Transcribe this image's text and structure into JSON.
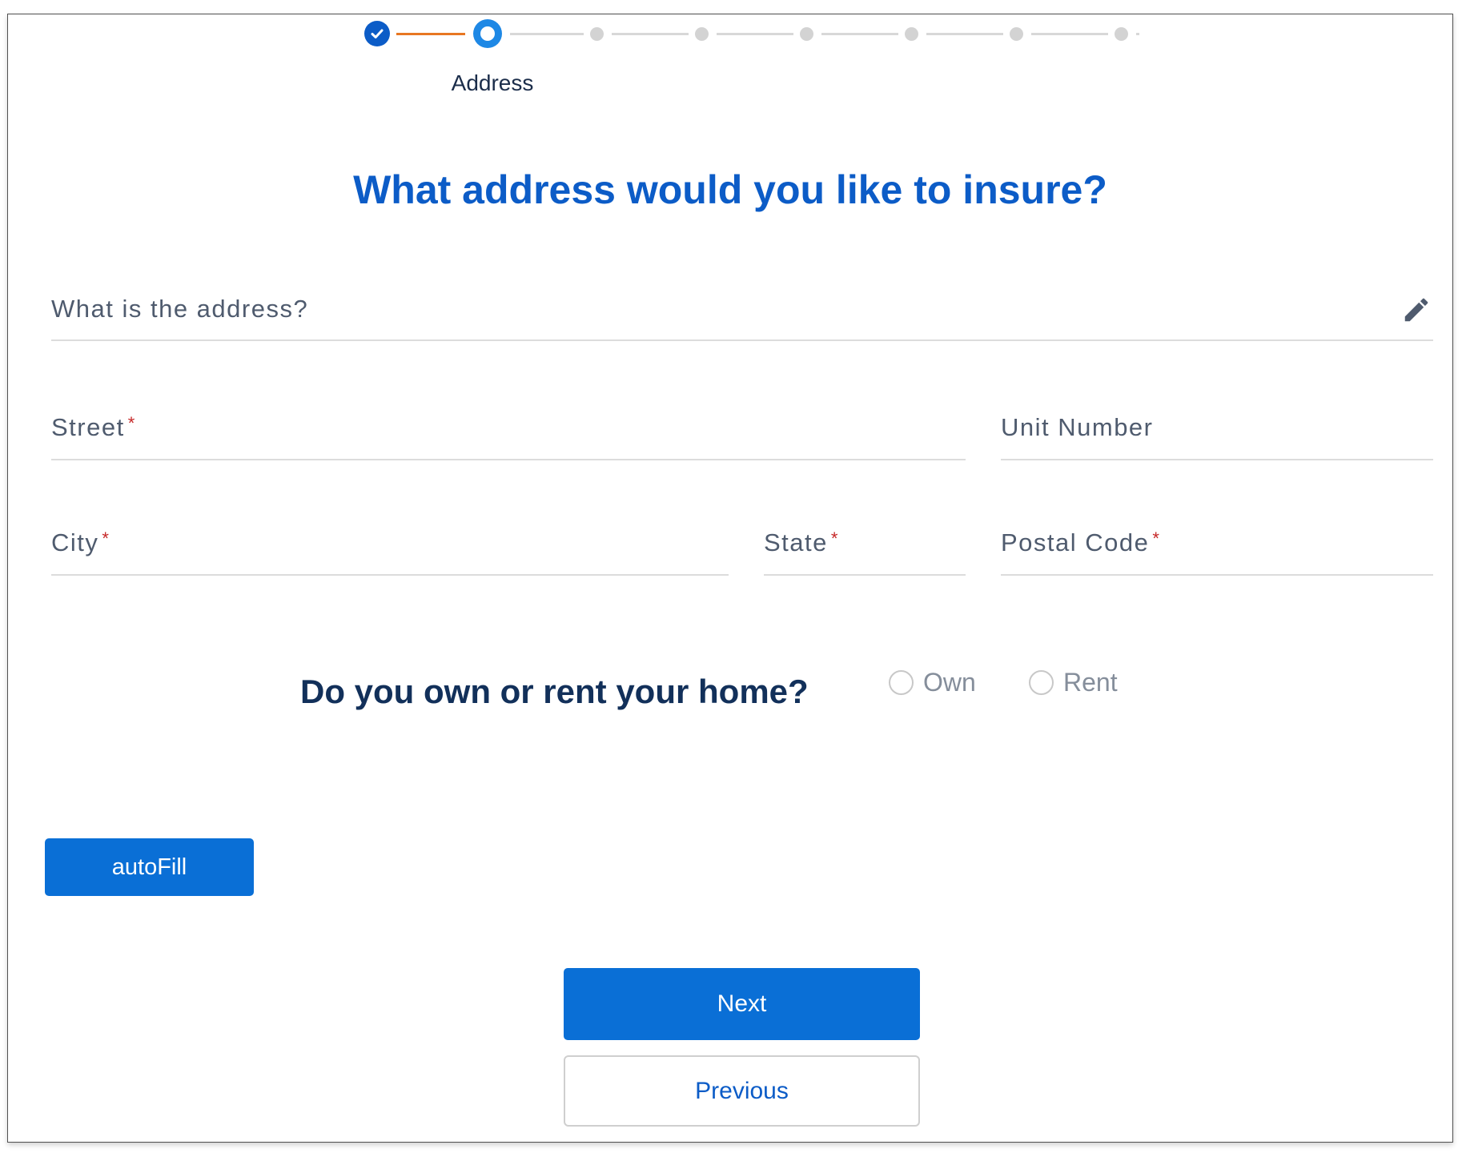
{
  "stepper": {
    "current_step_label": "Address"
  },
  "headline": "What address would you like to insure?",
  "fields": {
    "address_search": {
      "label": "What is the address?"
    },
    "street": {
      "label": "Street",
      "required_mark": "*"
    },
    "unit_number": {
      "label": "Unit Number"
    },
    "city": {
      "label": "City",
      "required_mark": "*"
    },
    "state": {
      "label": "State",
      "required_mark": "*"
    },
    "postal_code": {
      "label": "Postal Code",
      "required_mark": "*"
    }
  },
  "ownership": {
    "question": "Do you own or rent your home?",
    "options": [
      "Own",
      "Rent"
    ]
  },
  "buttons": {
    "autofill": "autoFill",
    "next": "Next",
    "previous": "Previous"
  },
  "colors": {
    "primary_blue": "#0a6fd6",
    "heading_blue": "#0c5cc7",
    "progress_orange": "#e87722",
    "required_red": "#c62828"
  },
  "icons": {
    "completed_step": "check-circle-icon",
    "address_edit": "pencil-icon"
  }
}
